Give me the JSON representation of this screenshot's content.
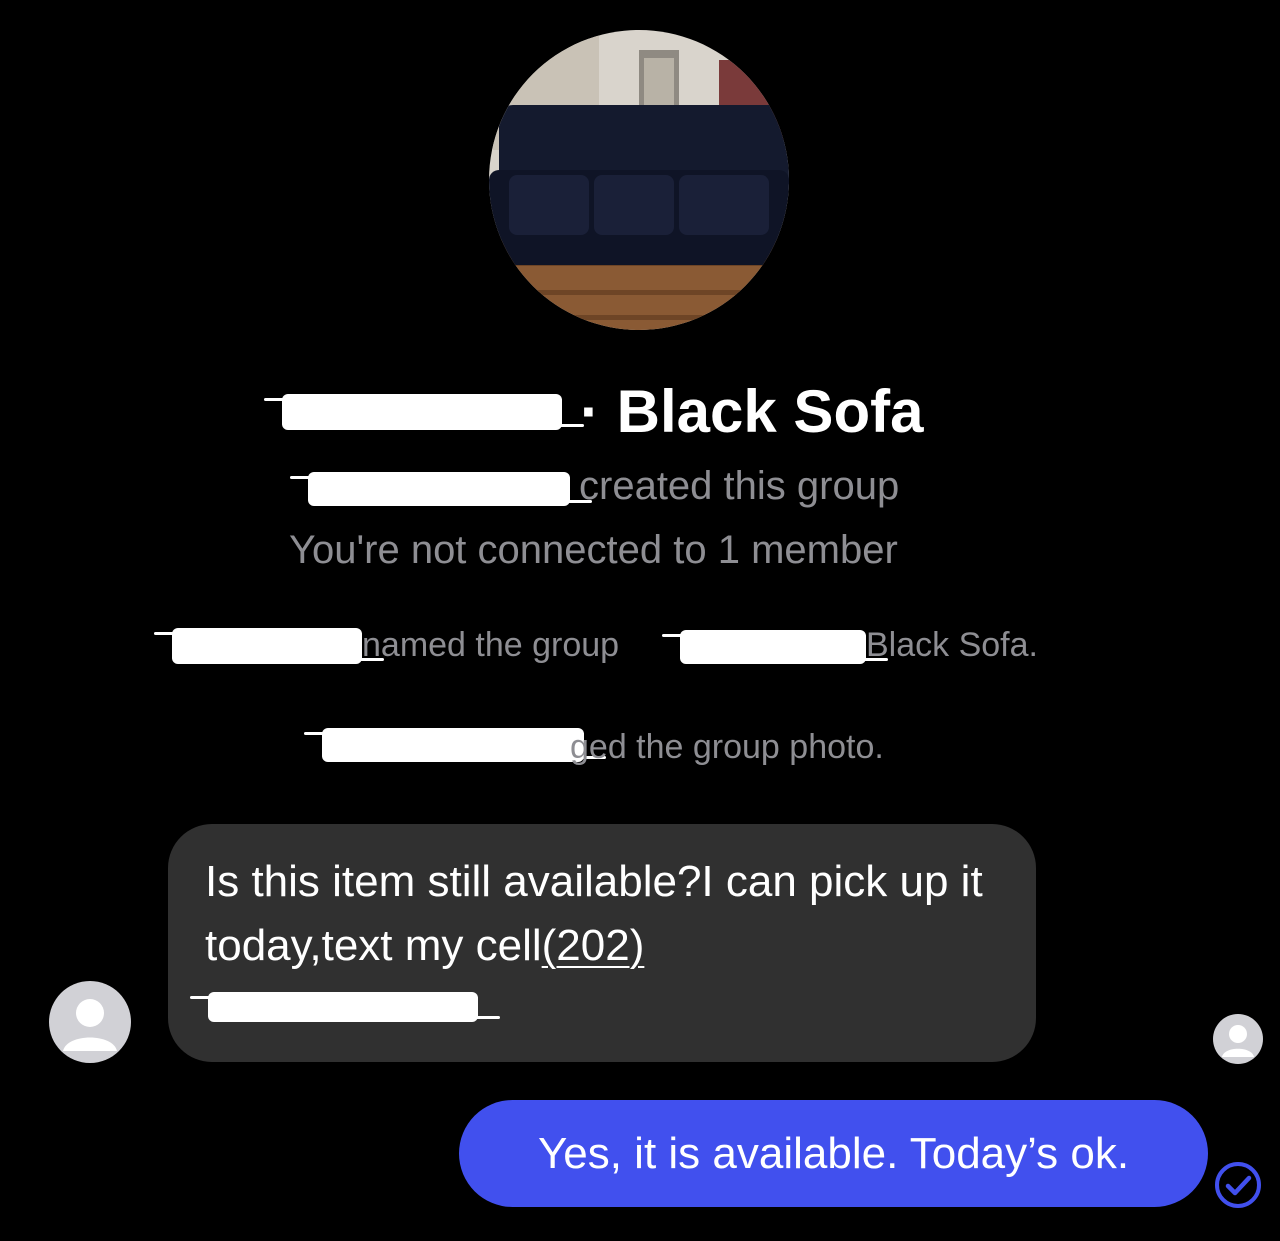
{
  "header": {
    "name_separator": "·",
    "group_title": "Black Sofa",
    "group_photo_icon": "sofa-photo"
  },
  "system_messages": {
    "created": "created this group",
    "not_connected": "You're not connected to 1 member",
    "renamed_prefix": "named the group",
    "renamed_suffix": "Black Sofa.",
    "photo_changed": "ged the group photo."
  },
  "messages": {
    "incoming_text": "Is this item still available?I can pick up it today,text my cell",
    "incoming_phone": "(202)",
    "outgoing_text": "Yes, it is available. Today’s ok."
  },
  "icons": {
    "sender_avatar": "person-placeholder-icon",
    "seen_avatar": "person-placeholder-icon",
    "read_receipt": "check-circle-icon"
  },
  "colors": {
    "background": "#000000",
    "incoming_bubble": "#303030",
    "outgoing_bubble": "#4150ee",
    "system_text": "#8e8e93"
  }
}
